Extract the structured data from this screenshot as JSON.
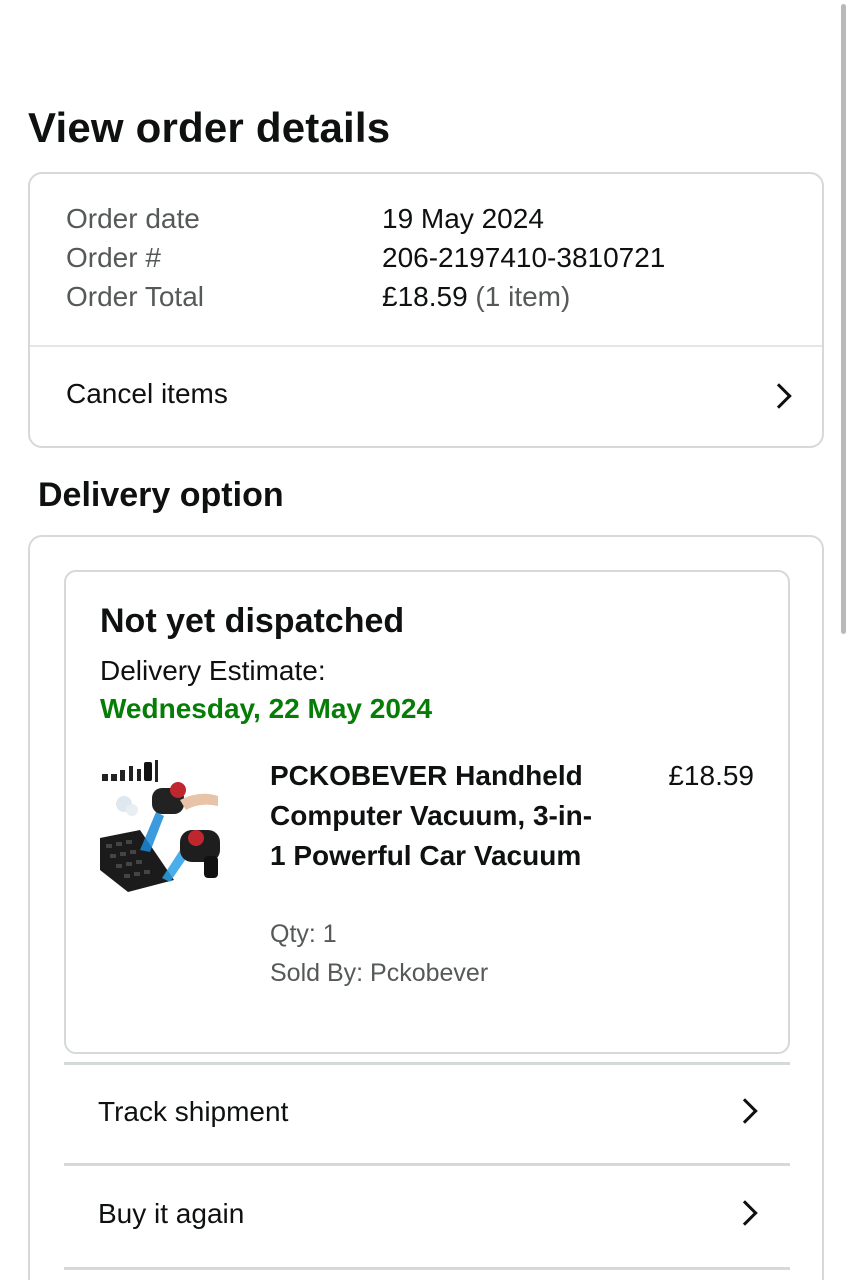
{
  "page": {
    "title": "View order details"
  },
  "order_summary": {
    "date_label": "Order date",
    "date_value": "19 May 2024",
    "number_label": "Order #",
    "number_value": "206-2197410-3810721",
    "total_label": "Order Total",
    "total_value": "£18.59",
    "total_items": "(1 item)",
    "cancel_label": "Cancel items"
  },
  "delivery": {
    "section_title": "Delivery option",
    "status": "Not yet dispatched",
    "estimate_label": "Delivery Estimate:",
    "estimate_date": "Wednesday, 22 May 2024",
    "estimate_color": "#067d06",
    "product": {
      "name": "PCKOBEVER Handheld Computer Vacuum, 3-in-1 Powerful Car Vacuum",
      "price": "£18.59",
      "qty": "Qty: 1",
      "seller": "Sold By: Pckobever",
      "image_icon": "handheld-vacuum-product-image"
    },
    "actions": {
      "track_label": "Track shipment",
      "buy_again_label": "Buy it again"
    }
  }
}
